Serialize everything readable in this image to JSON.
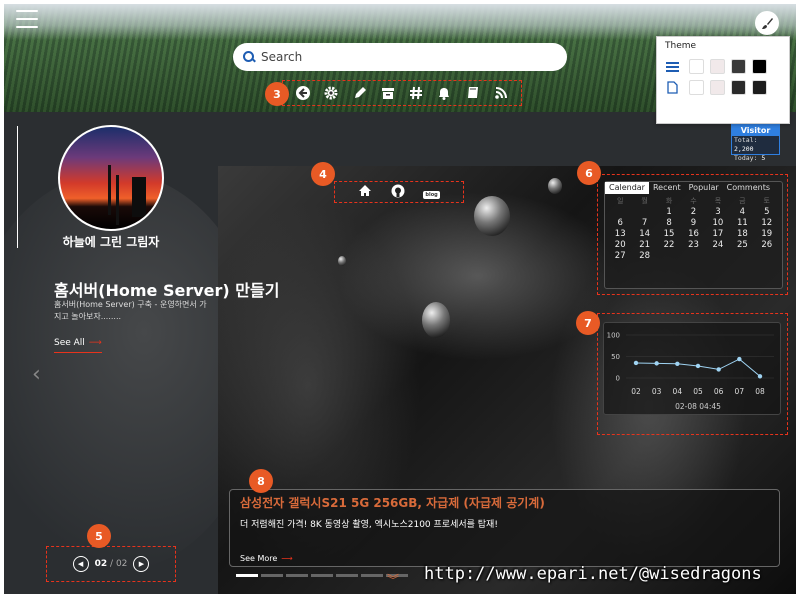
{
  "header": {
    "search_placeholder": "Search"
  },
  "toolbar": {
    "icons": [
      "back-arrow-icon",
      "gear-icon",
      "pencil-icon",
      "archive-icon",
      "hashtag-icon",
      "bell-icon",
      "book-icon",
      "rss-icon"
    ]
  },
  "theme_popup": {
    "title": "Theme",
    "row1_swatches": [
      "#ffffff",
      "#f1e9ea",
      "#3a3a3a",
      "#000000"
    ],
    "row2_swatches": [
      "#ffffff",
      "#f1e9ea",
      "#2a2a2a",
      "#1c1c1c"
    ]
  },
  "visitor": {
    "title": "Visitor",
    "total_label": "Total:",
    "total_value": "2,200",
    "today_label": "Today:",
    "today_value": "5"
  },
  "profile": {
    "name": "하늘에 그린 그림자"
  },
  "featured_post": {
    "title": "홈서버(Home Server) 만들기",
    "description": "홈서버(Home Server) 구축 - 운영하면서 가지고 놀아보자........",
    "see_all": "See All"
  },
  "pager": {
    "current": "02",
    "separator": "/",
    "total": "02"
  },
  "social": {
    "blog_badge": "blog"
  },
  "calendar": {
    "tabs": [
      "Calendar",
      "Recent",
      "Popular",
      "Comments"
    ],
    "weekdays": [
      "일",
      "월",
      "화",
      "수",
      "목",
      "금",
      "토"
    ],
    "days": [
      "",
      "",
      "",
      "",
      "",
      "",
      "",
      "",
      "",
      "1",
      "2",
      "3",
      "4",
      "5",
      "6",
      "7",
      "8",
      "9",
      "10",
      "11",
      "12",
      "13",
      "14",
      "15",
      "16",
      "17",
      "18",
      "19",
      "20",
      "21",
      "22",
      "23",
      "24",
      "25",
      "26",
      "27",
      "28",
      "",
      "",
      "",
      "",
      ""
    ]
  },
  "chart_data": {
    "type": "line",
    "categories": [
      "02",
      "03",
      "04",
      "05",
      "06",
      "07",
      "08"
    ],
    "series": [
      {
        "values": [
          35,
          34,
          33,
          28,
          20,
          44,
          4
        ]
      }
    ],
    "ylim": [
      0,
      100
    ],
    "yticks": [
      "100",
      "50",
      "0"
    ],
    "caption": "02-08 04:45",
    "colors": {
      "line": "#9fd3f2",
      "point": "#9fd3f2"
    }
  },
  "news": {
    "title": "삼성전자 갤럭시S21 5G 256GB, 자급제 (자급제 공기계)",
    "body": "더 저렴해진 가격! 8K 동영상 촬영, 엑시노스2100 프로세서를 탑재!",
    "see_more": "See More"
  },
  "slider": {
    "dot_count": 7,
    "active_index": 0
  },
  "callouts": [
    "3",
    "4",
    "5",
    "6",
    "7",
    "8"
  ],
  "watermark": "http://www.epari.net/@wisedragons",
  "colors": {
    "accent": "#e8331c",
    "callout": "#e85a25",
    "news_title": "#d86a3a",
    "visitor_header": "#2f7fe0"
  }
}
